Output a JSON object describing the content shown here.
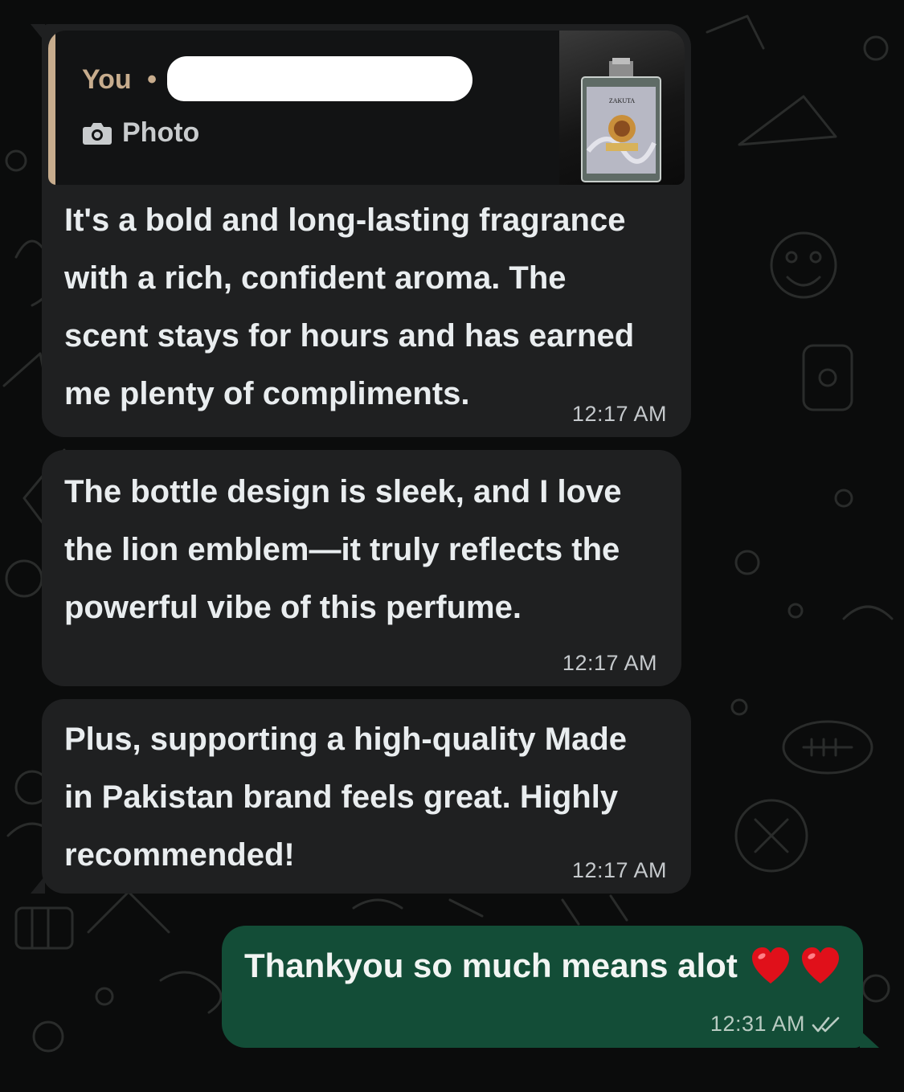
{
  "colors": {
    "incoming_bubble": "#1f2021",
    "outgoing_bubble": "#134d37",
    "quote_accent": "#c7ac8d",
    "background": "#0b0c0c"
  },
  "messages": [
    {
      "direction": "incoming",
      "reply_to": {
        "author": "You",
        "separator": "•",
        "media_icon": "camera-icon",
        "media_label": "Photo",
        "thumbnail_brand": "ZAKUTA"
      },
      "text": "It's a bold and long-lasting fragrance\nwith a rich, confident aroma. The\nscent stays for hours and has earned\nme plenty of compliments.",
      "time": "12:17 AM"
    },
    {
      "direction": "incoming",
      "text": "The bottle design is sleek, and I love\nthe lion emblem—it truly reflects the\npowerful vibe of this perfume.",
      "time": "12:17 AM"
    },
    {
      "direction": "incoming",
      "text": "Plus, supporting a high-quality Made\nin Pakistan brand feels great. Highly\nrecommended!",
      "time": "12:17 AM"
    },
    {
      "direction": "outgoing",
      "text": "Thankyou so much means alot",
      "emoji": [
        "heart-emoji",
        "heart-emoji"
      ],
      "time": "12:31 AM",
      "status_icon": "double-check-icon"
    }
  ]
}
